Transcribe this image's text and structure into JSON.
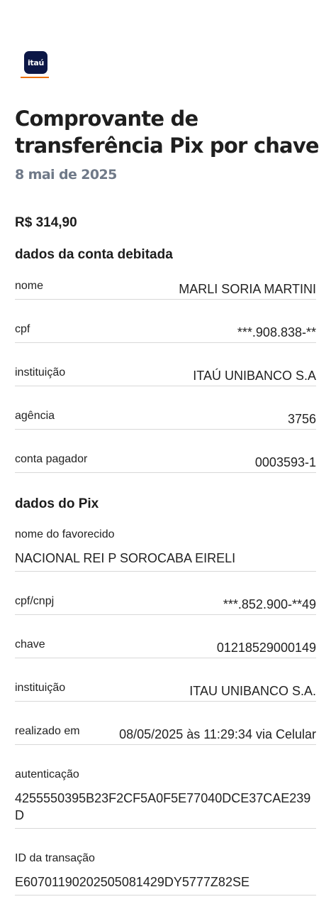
{
  "brand": {
    "logo_text": "itaú",
    "logo_bg": "#0c1746",
    "accent": "#ec7000"
  },
  "header": {
    "title": "Comprovante de transferência Pix por chave",
    "date": "8 mai de 2025"
  },
  "amount": "R$ 314,90",
  "debit_account": {
    "section_title": "dados da conta debitada",
    "rows": [
      {
        "label": "nome",
        "value": "MARLI SORIA MARTINI"
      },
      {
        "label": "cpf",
        "value": "***.908.838-**"
      },
      {
        "label": "instituição",
        "value": "ITAÚ UNIBANCO S.A"
      },
      {
        "label": "agência",
        "value": "3756"
      },
      {
        "label": "conta pagador",
        "value": "0003593-1"
      }
    ]
  },
  "pix": {
    "section_title": "dados do Pix",
    "payee_label": "nome do favorecido",
    "payee_value": "NACIONAL REI P SOROCABA EIRELI",
    "rows": [
      {
        "label": "cpf/cnpj",
        "value": "***.852.900-**49"
      },
      {
        "label": "chave",
        "value": "01218529000149"
      },
      {
        "label": "instituição",
        "value": "ITAU UNIBANCO S.A."
      },
      {
        "label": "realizado em",
        "value": "08/05/2025 às 11:29:34 via Celular"
      }
    ],
    "auth_label": "autenticação",
    "auth_value": "4255550395B23F2CF5A0F5E77040DCE37CAE239D",
    "txid_label": "ID da transação",
    "txid_value": "E60701190202505081429DY5777Z82SE"
  }
}
